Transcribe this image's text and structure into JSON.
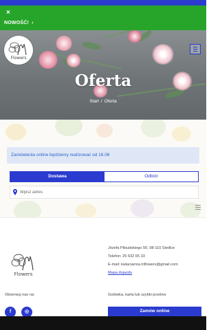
{
  "banner": {
    "close_glyph": "×",
    "label": "NOWOŚĆ!",
    "chevron": "›"
  },
  "logo": {
    "brand_text": "Flowers"
  },
  "hero": {
    "title": "Oferta",
    "breadcrumb": {
      "home": "Start",
      "separator": "/",
      "current": "Oferta"
    }
  },
  "notice": {
    "text": "Zamówienia online będziemy realizować od 16.06"
  },
  "delivery_tabs": [
    {
      "label": "Dostawa",
      "active": true
    },
    {
      "label": "Odbiór",
      "active": false
    }
  ],
  "address": {
    "placeholder": "Wpisz adres"
  },
  "footer": {
    "brand_text": "Flowers",
    "contact": {
      "address": "Józefa Piłsudskiego 50, 08-110 Siedlce",
      "phone": "Telefon: 25 632 65 33",
      "email": "E-mail: kwiaciarnia.mflowers@gmail.com",
      "map_link": "Mapa dojazdu"
    },
    "follow_label": "Obserwuj nas na:",
    "social": [
      {
        "icon": "facebook-icon",
        "glyph": "f"
      },
      {
        "icon": "instagram-icon",
        "glyph": "◎"
      }
    ],
    "payment_text": "Gotówka, karta lub szybki przelew",
    "order_button": "Zamów online"
  },
  "colors": {
    "accent_blue": "#2b3bd0",
    "banner_green": "#27a52a",
    "notice_bg": "#dfe7f7",
    "notice_text": "#2b63c8"
  }
}
